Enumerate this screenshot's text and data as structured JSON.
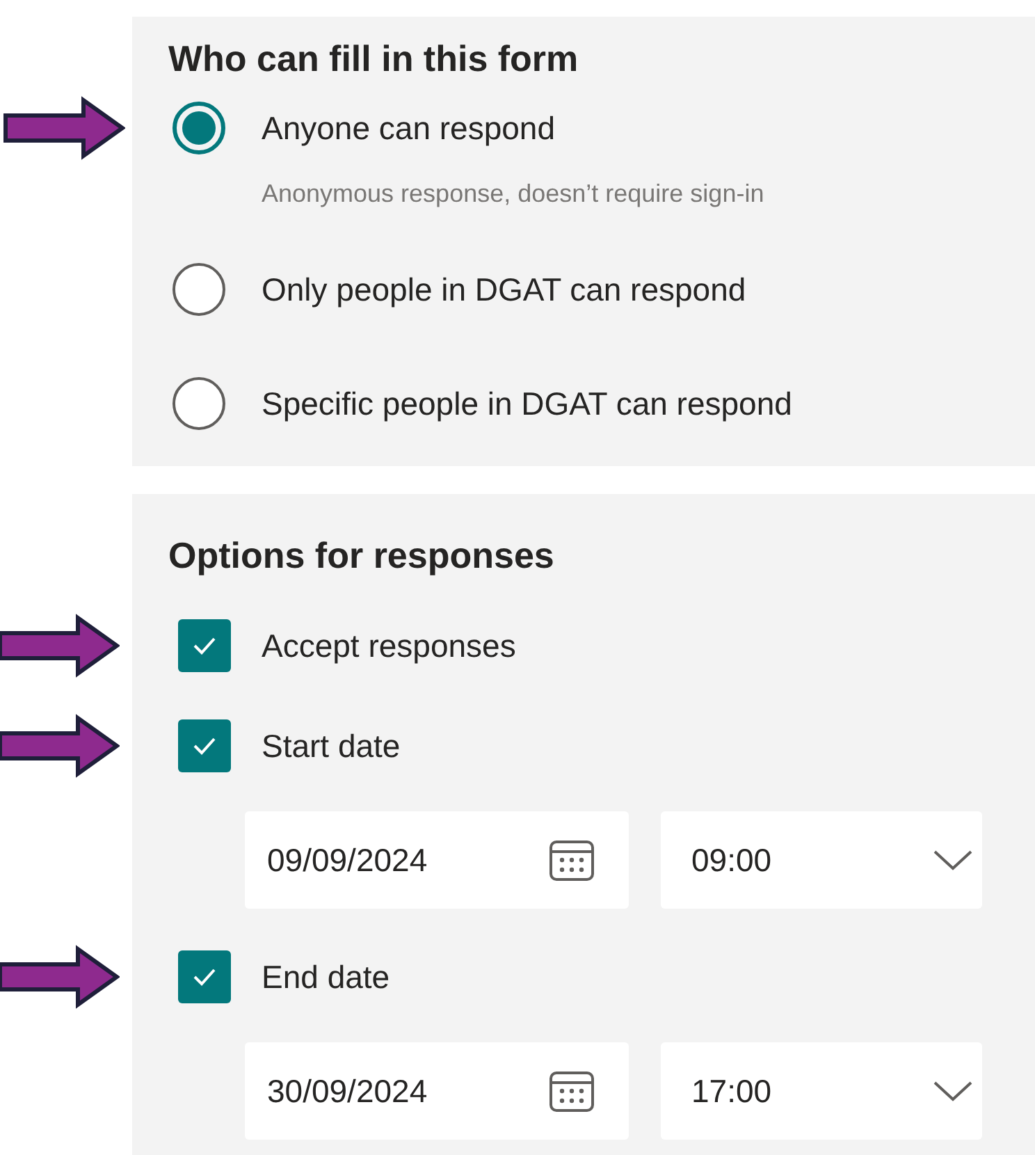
{
  "who_can_fill": {
    "title": "Who can fill in this form",
    "options": [
      {
        "label": "Anyone can respond",
        "selected": true,
        "pointed": true,
        "description": "Anonymous response, doesn’t require sign-in"
      },
      {
        "label": "Only people in DGAT can respond",
        "selected": false,
        "pointed": false
      },
      {
        "label": "Specific people in DGAT can respond",
        "selected": false,
        "pointed": false
      }
    ]
  },
  "response_options": {
    "title": "Options for responses",
    "items": [
      {
        "label": "Accept responses",
        "checked": true,
        "pointed": true
      },
      {
        "label": "Start date",
        "checked": true,
        "pointed": true,
        "date": "09/09/2024",
        "time": "09:00"
      },
      {
        "label": "End date",
        "checked": true,
        "pointed": true,
        "date": "30/09/2024",
        "time": "17:00"
      }
    ]
  }
}
